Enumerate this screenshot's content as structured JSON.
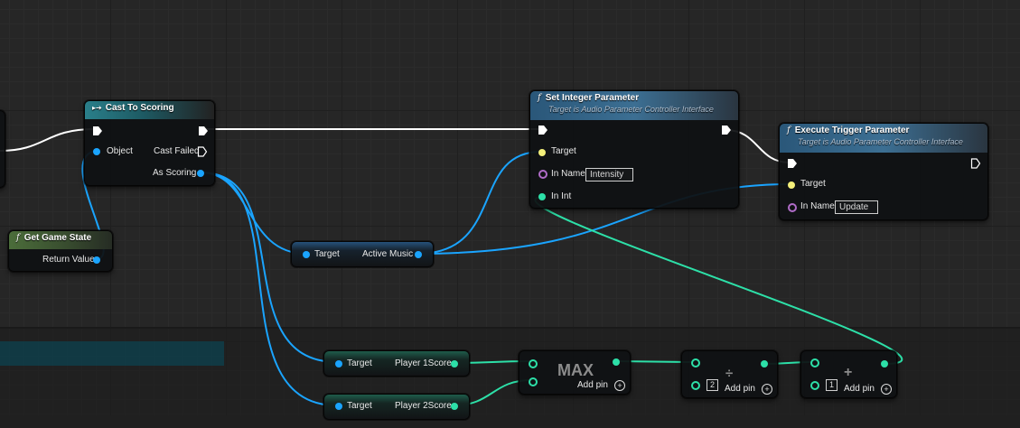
{
  "nodes": {
    "cast_to_scoring": {
      "title": "Cast To Scoring",
      "object_label": "Object",
      "cast_failed_label": "Cast Failed",
      "as_scoring_label": "As Scoring"
    },
    "get_game_state": {
      "title": "Get Game State",
      "return_value_label": "Return Value"
    },
    "active_music": {
      "target_label": "Target",
      "output_label": "Active Music"
    },
    "set_integer_parameter": {
      "title": "Set Integer Parameter",
      "subtitle": "Target is Audio Parameter Controller Interface",
      "target_label": "Target",
      "in_name_label": "In Name",
      "in_name_value": "Intensity",
      "in_int_label": "In Int"
    },
    "execute_trigger_parameter": {
      "title": "Execute Trigger Parameter",
      "subtitle": "Target is Audio Parameter Controller Interface",
      "target_label": "Target",
      "in_name_label": "In Name",
      "in_name_value": "Update"
    },
    "player1_score": {
      "target_label": "Target",
      "output_label": "Player 1Score"
    },
    "player2_score": {
      "target_label": "Target",
      "output_label": "Player 2Score"
    },
    "max": {
      "title": "MAX",
      "add_pin_label": "Add pin"
    },
    "divide": {
      "symbol": "÷",
      "value": "2",
      "add_pin_label": "Add pin"
    },
    "add": {
      "symbol": "+",
      "value": "1",
      "add_pin_label": "Add pin"
    }
  },
  "colors": {
    "exec_wire": "#ffffff",
    "object_wire": "#1aa4ff",
    "int_wire": "#2de0a8",
    "name_pin": "#b06cc8",
    "interface_pin": "#f4f07a"
  }
}
